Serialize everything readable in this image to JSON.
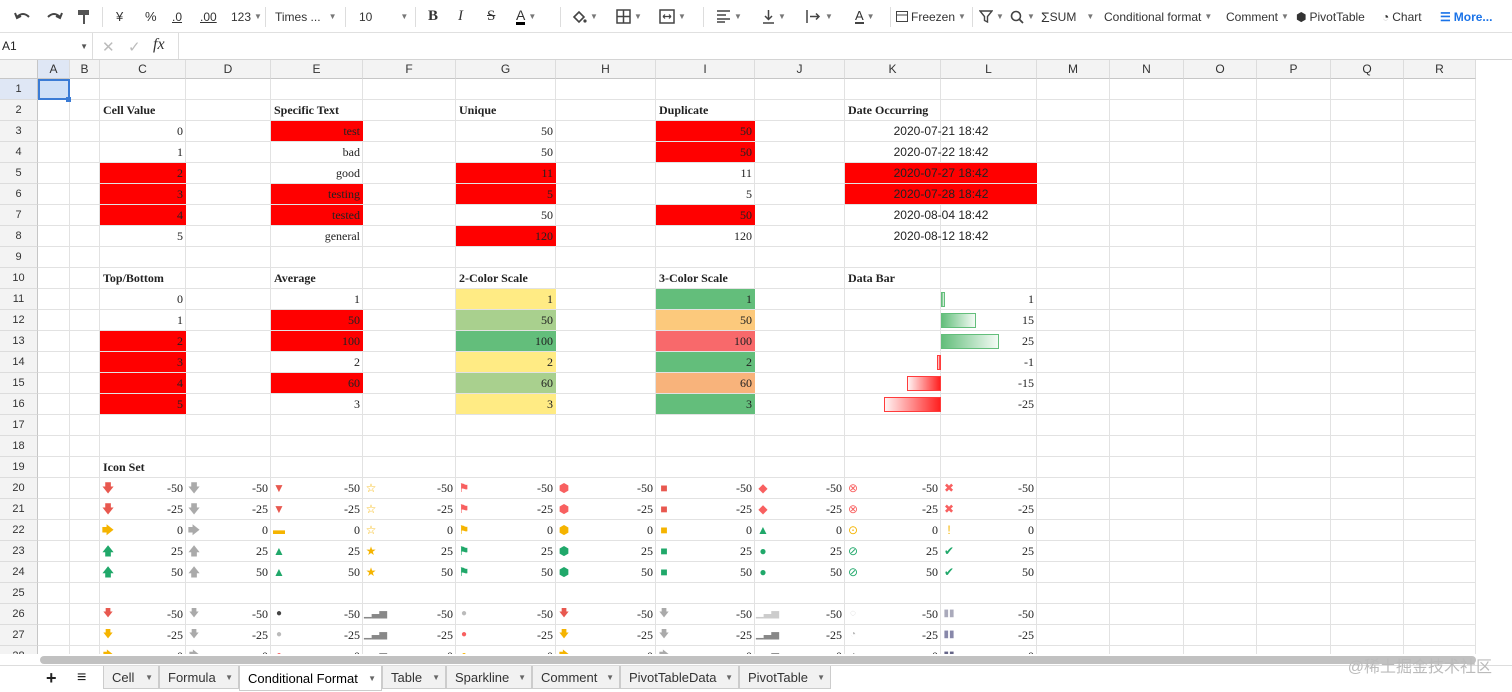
{
  "toolbar": {
    "font_family": "Times ...",
    "font_size": "10",
    "number_format": "123",
    "currency": "¥",
    "percent": "%",
    "dec_less": ".0",
    "dec_more": ".00",
    "freeze": "Freezen",
    "sum": "SUM",
    "conditional_format": "Conditional format",
    "comment": "Comment",
    "pivot": "PivotTable",
    "chart": "Chart",
    "more": "More..."
  },
  "formula_bar": {
    "cell_ref": "A1",
    "value": ""
  },
  "columns": [
    "A",
    "B",
    "C",
    "D",
    "E",
    "F",
    "G",
    "H",
    "I",
    "J",
    "K",
    "L",
    "M",
    "N",
    "O",
    "P",
    "Q",
    "R"
  ],
  "rows": [
    "1",
    "2",
    "3",
    "4",
    "5",
    "6",
    "7",
    "8",
    "9",
    "10",
    "11",
    "12",
    "13",
    "14",
    "15",
    "16",
    "17",
    "18",
    "19",
    "20",
    "21",
    "22",
    "23",
    "24",
    "25",
    "26",
    "27",
    "28"
  ],
  "colors": {
    "highlight": "#ff0000",
    "green": "#63be7b",
    "yellow": "#ffeb84",
    "orange": "#f8b37b",
    "pink": "#f8696b",
    "light_green": "#a9d08e"
  },
  "sections": {
    "cell_value": {
      "title": "Cell Value",
      "values": [
        "0",
        "1",
        "2",
        "3",
        "4",
        "5"
      ]
    },
    "specific_text": {
      "title": "Specific Text",
      "values": [
        "test",
        "bad",
        "good",
        "testing",
        "tested",
        "general"
      ]
    },
    "unique": {
      "title": "Unique",
      "values": [
        "50",
        "50",
        "11",
        "5",
        "50",
        "120"
      ]
    },
    "duplicate": {
      "title": "Duplicate",
      "values": [
        "50",
        "50",
        "11",
        "5",
        "50",
        "120"
      ]
    },
    "date_occurring": {
      "title": "Date Occurring",
      "values": [
        "2020-07-21 18:42",
        "2020-07-22 18:42",
        "2020-07-27 18:42",
        "2020-07-28 18:42",
        "2020-08-04 18:42",
        "2020-08-12 18:42"
      ]
    },
    "top_bottom": {
      "title": "Top/Bottom",
      "values": [
        "0",
        "1",
        "2",
        "3",
        "4",
        "5"
      ]
    },
    "average": {
      "title": "Average",
      "values": [
        "1",
        "50",
        "100",
        "2",
        "60",
        "3"
      ]
    },
    "two_color": {
      "title": "2-Color Scale",
      "values": [
        "1",
        "50",
        "100",
        "2",
        "60",
        "3"
      ]
    },
    "three_color": {
      "title": "3-Color Scale",
      "values": [
        "1",
        "50",
        "100",
        "2",
        "60",
        "3"
      ]
    },
    "data_bar": {
      "title": "Data Bar",
      "values": [
        "1",
        "15",
        "25",
        "-1",
        "-15",
        "-25"
      ]
    },
    "icon_set": {
      "title": "Icon Set",
      "rows": [
        [
          "-50",
          "-25",
          "0",
          "25",
          "50"
        ],
        [
          "-50",
          "-25",
          "0",
          "25",
          "50"
        ],
        [
          "-50",
          "-25",
          "0",
          "25",
          "50"
        ]
      ]
    }
  },
  "sheet_tabs": [
    "Cell",
    "Formula",
    "Conditional Format",
    "Table",
    "Sparkline",
    "Comment",
    "PivotTableData",
    "PivotTable"
  ],
  "active_tab": "Conditional Format",
  "watermark": "@稀土掘金技术社区"
}
